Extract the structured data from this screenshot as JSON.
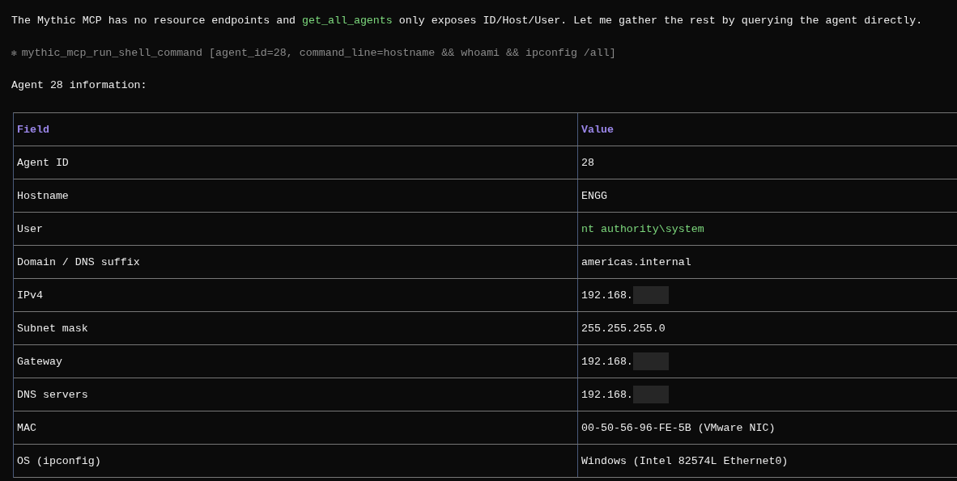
{
  "intro": [
    {
      "kind": "text",
      "text": "The Mythic MCP has no resource endpoints and "
    },
    {
      "kind": "code",
      "text": "get_all_agents"
    },
    {
      "kind": "text",
      "text": " only exposes ID/Host/User. Let me gather the rest by querying the agent directly."
    }
  ],
  "tool_call": {
    "glyph": "✻",
    "text": "mythic_mcp_run_shell_command [agent_id=28, command_line=hostname && whoami && ipconfig /all]"
  },
  "heading": "Agent 28 information:",
  "table": {
    "columns": [
      "Field",
      "Value"
    ],
    "rows": [
      {
        "field": "Agent ID",
        "value": "28",
        "highlighted": false,
        "redacted": false
      },
      {
        "field": "Hostname",
        "value": "ENGG",
        "highlighted": false,
        "redacted": false
      },
      {
        "field": "User",
        "value": "nt authority\\system",
        "highlighted": true,
        "redacted": false
      },
      {
        "field": "Domain / DNS suffix",
        "value": "americas.internal",
        "highlighted": false,
        "redacted": false
      },
      {
        "field": "IPv4",
        "value": "192.168.",
        "highlighted": false,
        "redacted": true
      },
      {
        "field": "Subnet mask",
        "value": "255.255.255.0",
        "highlighted": false,
        "redacted": false
      },
      {
        "field": "Gateway",
        "value": "192.168.",
        "highlighted": false,
        "redacted": true
      },
      {
        "field": "DNS servers",
        "value": "192.168.",
        "highlighted": false,
        "redacted": true
      },
      {
        "field": "MAC",
        "value": "00-50-56-96-FE-5B (VMware NIC)",
        "highlighted": false,
        "redacted": false
      },
      {
        "field": "OS (ipconfig)",
        "value": "Windows (Intel 82574L Ethernet0)",
        "highlighted": false,
        "redacted": false
      }
    ]
  }
}
